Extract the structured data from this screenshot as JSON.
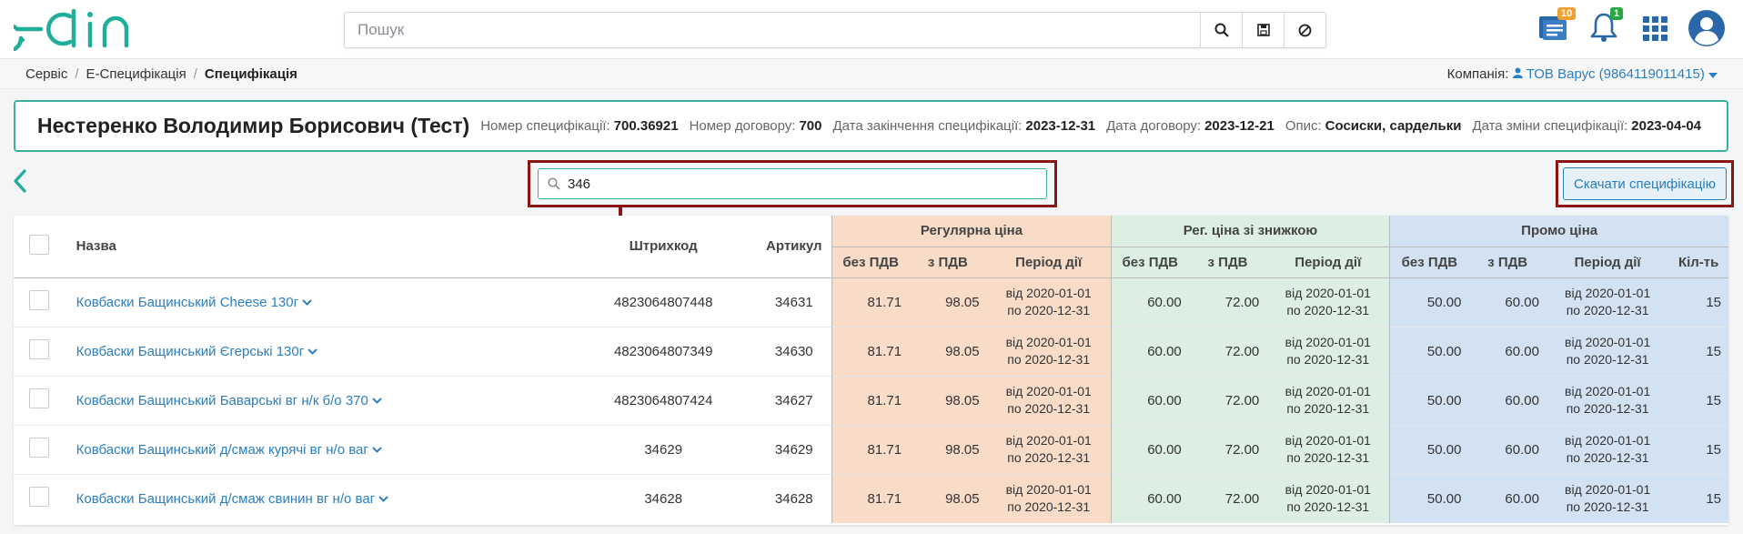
{
  "header": {
    "logo_text": "edin",
    "search_placeholder": "Пошук",
    "docs_badge": "10",
    "notif_badge": "1",
    "colors": {
      "brand": "#1fae9a",
      "link": "#2a7ec1",
      "highlight": "#8b1414"
    }
  },
  "breadcrumb": {
    "items": [
      "Сервіс",
      "Е-Специфікація",
      "Специфікація"
    ]
  },
  "company": {
    "label": "Компанія:",
    "value": "ТОВ Варус (9864119011415)"
  },
  "info": {
    "name": "Нестеренко Володимир Борисович (Тест)",
    "spec_no_label": "Номер специфікації:",
    "spec_no": "700.36921",
    "contract_no_label": "Номер договору:",
    "contract_no": "700",
    "end_date_label": "Дата закінчення специфікації:",
    "end_date": "2023-12-31",
    "contract_date_label": "Дата договору:",
    "contract_date": "2023-12-21",
    "desc_label": "Опис:",
    "desc": "Сосиски, сардельки",
    "changed_label": "Дата зміни специфікації:",
    "changed": "2023-04-04"
  },
  "filter": {
    "value": "346"
  },
  "download_button": "Скачати специфікацію",
  "table": {
    "col_name": "Назва",
    "col_barcode": "Штрихкод",
    "col_article": "Артикул",
    "group_regular": "Регулярна ціна",
    "group_discount": "Рег. ціна зі знижкою",
    "group_promo": "Промо ціна",
    "sub_no_vat": "без ПДВ",
    "sub_vat": "з ПДВ",
    "sub_period": "Період дії",
    "sub_qty": "Кіл-ть",
    "rows": [
      {
        "name": "Ковбаски Бащинський Cheese 130г",
        "barcode": "4823064807448",
        "article": "34631",
        "reg_no_vat": "81.71",
        "reg_vat": "98.05",
        "reg_from": "від 2020-01-01",
        "reg_to": "по 2020-12-31",
        "disc_no_vat": "60.00",
        "disc_vat": "72.00",
        "disc_from": "від 2020-01-01",
        "disc_to": "по 2020-12-31",
        "promo_no_vat": "50.00",
        "promo_vat": "60.00",
        "promo_from": "від 2020-01-01",
        "promo_to": "по 2020-12-31",
        "qty": "15"
      },
      {
        "name": "Ковбаски Бащинський Єгерські 130г",
        "barcode": "4823064807349",
        "article": "34630",
        "reg_no_vat": "81.71",
        "reg_vat": "98.05",
        "reg_from": "від 2020-01-01",
        "reg_to": "по 2020-12-31",
        "disc_no_vat": "60.00",
        "disc_vat": "72.00",
        "disc_from": "від 2020-01-01",
        "disc_to": "по 2020-12-31",
        "promo_no_vat": "50.00",
        "promo_vat": "60.00",
        "promo_from": "від 2020-01-01",
        "promo_to": "по 2020-12-31",
        "qty": "15"
      },
      {
        "name": "Ковбаски Бащинський Баварські вг н/к б/о 370",
        "barcode": "4823064807424",
        "article": "34627",
        "reg_no_vat": "81.71",
        "reg_vat": "98.05",
        "reg_from": "від 2020-01-01",
        "reg_to": "по 2020-12-31",
        "disc_no_vat": "60.00",
        "disc_vat": "72.00",
        "disc_from": "від 2020-01-01",
        "disc_to": "по 2020-12-31",
        "promo_no_vat": "50.00",
        "promo_vat": "60.00",
        "promo_from": "від 2020-01-01",
        "promo_to": "по 2020-12-31",
        "qty": "15"
      },
      {
        "name": "Ковбаски Бащинський д/смаж курячі вг н/о ваг",
        "barcode": "34629",
        "article": "34629",
        "reg_no_vat": "81.71",
        "reg_vat": "98.05",
        "reg_from": "від 2020-01-01",
        "reg_to": "по 2020-12-31",
        "disc_no_vat": "60.00",
        "disc_vat": "72.00",
        "disc_from": "від 2020-01-01",
        "disc_to": "по 2020-12-31",
        "promo_no_vat": "50.00",
        "promo_vat": "60.00",
        "promo_from": "від 2020-01-01",
        "promo_to": "по 2020-12-31",
        "qty": "15"
      },
      {
        "name": "Ковбаски Бащинський д/смаж свинин вг н/о ваг",
        "barcode": "34628",
        "article": "34628",
        "reg_no_vat": "81.71",
        "reg_vat": "98.05",
        "reg_from": "від 2020-01-01",
        "reg_to": "по 2020-12-31",
        "disc_no_vat": "60.00",
        "disc_vat": "72.00",
        "disc_from": "від 2020-01-01",
        "disc_to": "по 2020-12-31",
        "promo_no_vat": "50.00",
        "promo_vat": "60.00",
        "promo_from": "від 2020-01-01",
        "promo_to": "по 2020-12-31",
        "qty": "15"
      }
    ]
  }
}
